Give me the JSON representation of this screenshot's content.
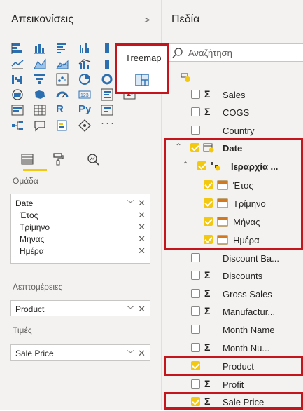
{
  "viz_pane": {
    "title": "Απεικονίσεις",
    "collapse_chevron": ">",
    "tooltip": "Treemap",
    "text_icons": [
      "R",
      "Py"
    ],
    "more_dots": "···"
  },
  "wells": {
    "group_label": "Ομάδα",
    "group_items": [
      "Date",
      "Έτος",
      "Τρίμηνο",
      "Μήνας",
      "Ημέρα"
    ],
    "details_label": "Λεπτομέρειες",
    "details_item": "Product",
    "values_label": "Τιμές",
    "values_item": "Sale Price",
    "remove_glyph": "✕",
    "dropdown_glyph": "﹀"
  },
  "fields_pane": {
    "title": "Πεδία",
    "search_placeholder": "Αναζήτηση",
    "fields": [
      {
        "name": "Sales",
        "sigma": "Σ",
        "checked": false
      },
      {
        "name": "COGS",
        "sigma": "Σ",
        "checked": false
      },
      {
        "name": "Country",
        "sigma": "",
        "checked": false
      },
      {
        "name": "Date",
        "checked": true
      },
      {
        "name": "Ιεραρχία ...",
        "checked": true
      },
      {
        "name": "Έτος",
        "checked": true
      },
      {
        "name": "Τρίμηνο",
        "checked": true
      },
      {
        "name": "Μήνας",
        "checked": true
      },
      {
        "name": "Ημέρα",
        "checked": true
      },
      {
        "name": "Discount Ba...",
        "sigma": "",
        "checked": false
      },
      {
        "name": "Discounts",
        "sigma": "Σ",
        "checked": false
      },
      {
        "name": "Gross Sales",
        "sigma": "Σ",
        "checked": false
      },
      {
        "name": "Manufactur...",
        "sigma": "Σ",
        "checked": false
      },
      {
        "name": "Month Name",
        "sigma": "",
        "checked": false
      },
      {
        "name": "Month Nu...",
        "sigma": "Σ",
        "checked": false
      },
      {
        "name": "Product",
        "sigma": "",
        "checked": true
      },
      {
        "name": "Profit",
        "sigma": "Σ",
        "checked": false
      },
      {
        "name": "Sale Price",
        "sigma": "Σ",
        "checked": true
      }
    ]
  },
  "colors": {
    "accent": "#f2c811",
    "highlight": "#c4151c",
    "brand_blue": "#2b6fb0"
  }
}
